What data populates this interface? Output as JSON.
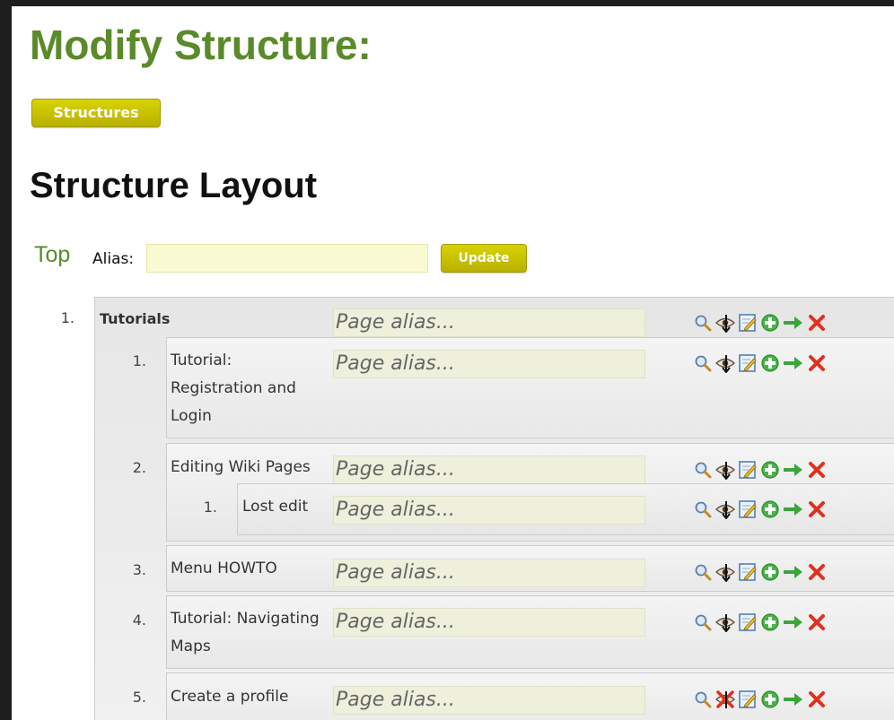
{
  "page": {
    "title": "Modify Structure:",
    "structures_button": "Structures",
    "section_title": "Structure Layout",
    "top_link": "Top",
    "alias_label": "Alias:",
    "update_button": "Update"
  },
  "tree": {
    "placeholder": "Page alias...",
    "items": [
      {
        "num": "1.",
        "label": "Tutorials"
      },
      {
        "num": "1.",
        "label": "Tutorial: Registration and Login"
      },
      {
        "num": "2.",
        "label": "Editing Wiki Pages"
      },
      {
        "num": "1.",
        "label": "Lost edit"
      },
      {
        "num": "3.",
        "label": "Menu HOWTO"
      },
      {
        "num": "4.",
        "label": "Tutorial: Navigating Maps"
      },
      {
        "num": "5.",
        "label": "Create a profile"
      }
    ]
  },
  "icons": [
    "search-icon",
    "eye-icon",
    "edit-icon",
    "add-icon",
    "move-right-icon",
    "delete-icon"
  ],
  "colors": {
    "heading_green": "#5a8a2a",
    "button_yellow": "#c8c400",
    "alias_bg": "#fafad2"
  }
}
